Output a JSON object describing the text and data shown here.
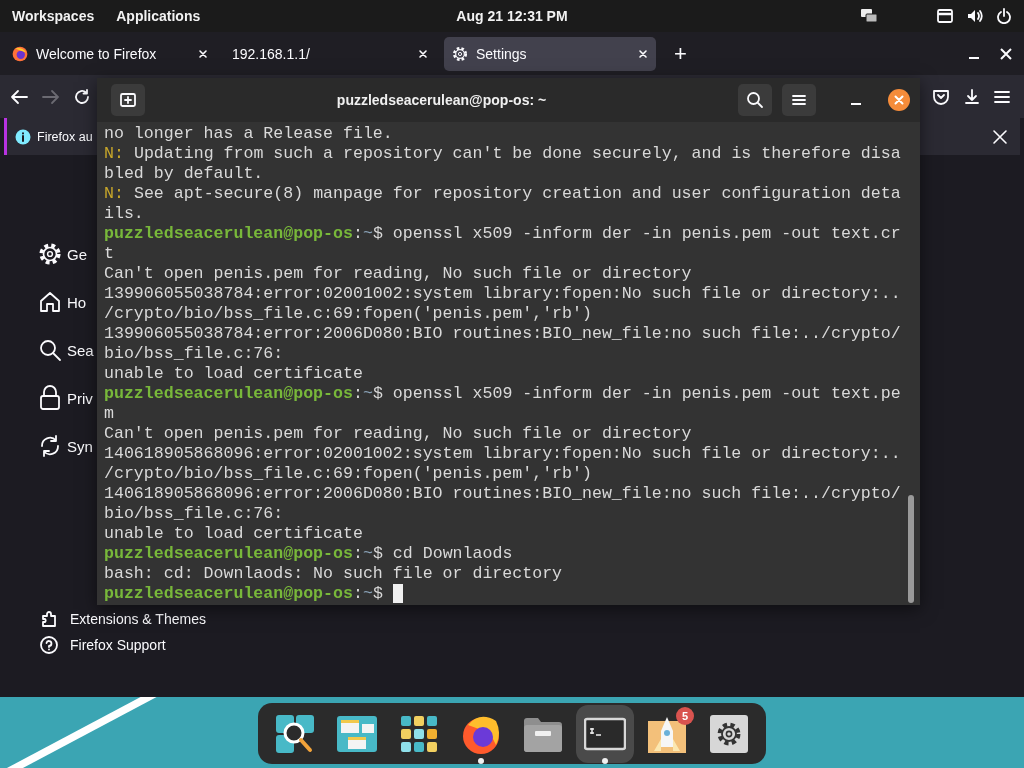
{
  "top_bar": {
    "workspaces": "Workspaces",
    "applications": "Applications",
    "clock": "Aug 21  12:31 PM"
  },
  "browser": {
    "tabs": [
      {
        "title": "Welcome to Firefox",
        "selected": false
      },
      {
        "title": "192.168.1.1/",
        "selected": false
      },
      {
        "title": "Settings",
        "selected": true
      }
    ],
    "new_tab": "+",
    "forward": {
      "disabled": true
    },
    "notification": {
      "text": "Firefox au"
    },
    "sidebar": {
      "items": [
        {
          "label": "Ge"
        },
        {
          "label": "Ho"
        },
        {
          "label": "Sea"
        },
        {
          "label": "Priv"
        },
        {
          "label": "Syn"
        }
      ],
      "footer_items": [
        {
          "label": "Extensions & Themes"
        },
        {
          "label": "Firefox Support"
        }
      ]
    }
  },
  "terminal": {
    "title": "puzzledseacerulean@pop-os: ~",
    "lines": [
      {
        "kind": "output",
        "text": "no longer has a Release file."
      },
      {
        "kind": "notice",
        "tag": "N:",
        "text": "Updating from such a repository can't be done securely, and is therefore disa"
      },
      {
        "kind": "output",
        "text": "bled by default."
      },
      {
        "kind": "notice",
        "tag": "N:",
        "text": "See apt-secure(8) manpage for repository creation and user configuration deta"
      },
      {
        "kind": "output",
        "text": "ils."
      },
      {
        "kind": "prompt",
        "user": "puzzledseacerulean@pop-os",
        "separator": ":",
        "path": "~",
        "symbol": "$",
        "command": "openssl x509 -inform der -in penis.pem -out text.cr"
      },
      {
        "kind": "output",
        "text": "t"
      },
      {
        "kind": "output",
        "text": "Can't open penis.pem for reading, No such file or directory"
      },
      {
        "kind": "output",
        "text": "139906055038784:error:02001002:system library:fopen:No such file or directory:.."
      },
      {
        "kind": "output",
        "text": "/crypto/bio/bss_file.c:69:fopen('penis.pem','rb')"
      },
      {
        "kind": "output",
        "text": "139906055038784:error:2006D080:BIO routines:BIO_new_file:no such file:../crypto/"
      },
      {
        "kind": "output",
        "text": "bio/bss_file.c:76:"
      },
      {
        "kind": "output",
        "text": "unable to load certificate"
      },
      {
        "kind": "prompt",
        "user": "puzzledseacerulean@pop-os",
        "separator": ":",
        "path": "~",
        "symbol": "$",
        "command": "openssl x509 -inform der -in penis.pem -out text.pe"
      },
      {
        "kind": "output",
        "text": "m"
      },
      {
        "kind": "output",
        "text": "Can't open penis.pem for reading, No such file or directory"
      },
      {
        "kind": "output",
        "text": "140618905868096:error:02001002:system library:fopen:No such file or directory:.."
      },
      {
        "kind": "output",
        "text": "/crypto/bio/bss_file.c:69:fopen('penis.pem','rb')"
      },
      {
        "kind": "output",
        "text": "140618905868096:error:2006D080:BIO routines:BIO_new_file:no such file:../crypto/"
      },
      {
        "kind": "output",
        "text": "bio/bss_file.c:76:"
      },
      {
        "kind": "output",
        "text": "unable to load certificate"
      },
      {
        "kind": "prompt",
        "user": "puzzledseacerulean@pop-os",
        "separator": ":",
        "path": "~",
        "symbol": "$",
        "command": "cd Downlaods"
      },
      {
        "kind": "output",
        "text": "bash: cd: Downlaods: No such file or directory"
      },
      {
        "kind": "prompt",
        "user": "puzzledseacerulean@pop-os",
        "separator": ":",
        "path": "~",
        "symbol": "$",
        "cursor": true
      }
    ]
  },
  "dock": {
    "apps": [
      {
        "running": false,
        "selected": false
      },
      {
        "running": false,
        "selected": false
      },
      {
        "running": false,
        "selected": false
      },
      {
        "running": true,
        "selected": false
      },
      {
        "running": false,
        "selected": false
      },
      {
        "running": true,
        "selected": true
      },
      {
        "running": false,
        "selected": false,
        "badge": "5"
      },
      {
        "running": false,
        "selected": false
      }
    ]
  }
}
